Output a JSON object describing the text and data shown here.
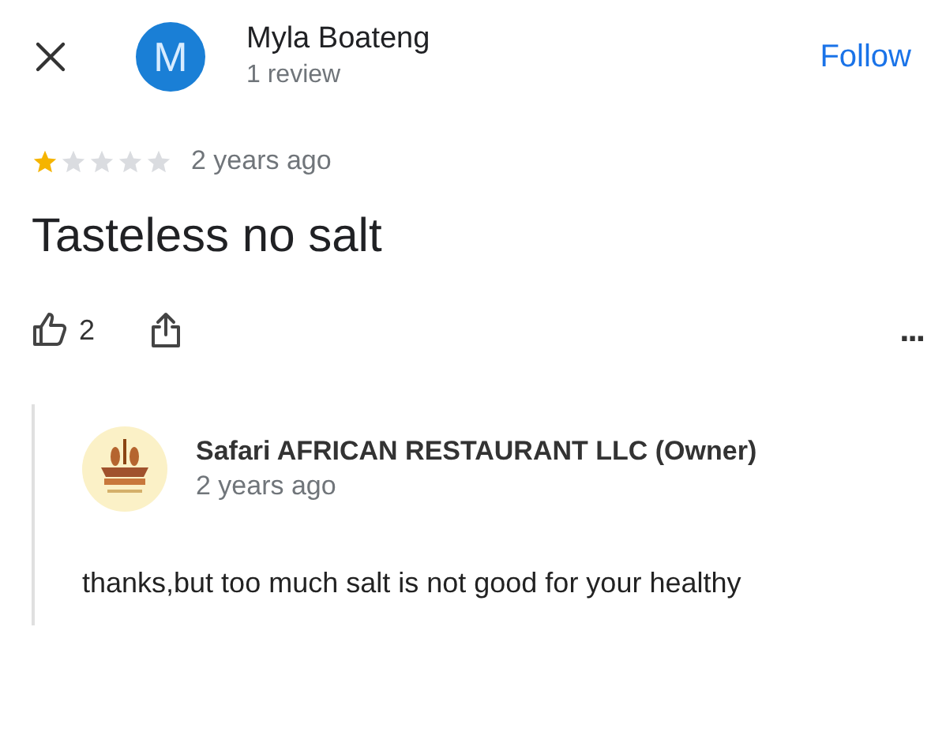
{
  "reviewer": {
    "avatar_letter": "M",
    "name": "Myla Boateng",
    "review_count": "1 review",
    "follow_label": "Follow"
  },
  "review": {
    "stars": 1,
    "time": "2 years ago",
    "text": "Tasteless no salt",
    "likes": "2",
    "more": "..."
  },
  "owner_reply": {
    "name": "Safari AFRICAN RESTAURANT LLC (Owner)",
    "time": "2 years ago",
    "text": "thanks,but too much salt is not good for your healthy"
  }
}
